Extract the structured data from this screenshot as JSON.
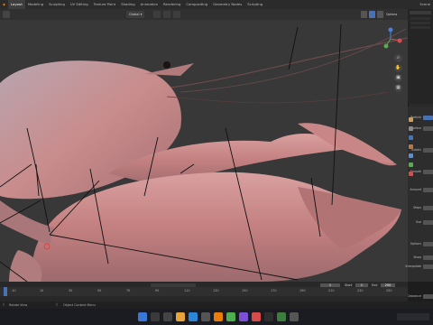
{
  "topbar": {
    "tabs": [
      "Layout",
      "Modeling",
      "Sculpting",
      "UV Editing",
      "Texture Paint",
      "Shading",
      "Animation",
      "Rendering",
      "Compositing",
      "Geometry Nodes",
      "Scripting"
    ],
    "active_tab": "Layout",
    "scene_label": "Scene"
  },
  "header": {
    "orientation_value": "Global",
    "options_label": "Options"
  },
  "timeline": {
    "frame_ticks": [
      "0",
      "20",
      "40",
      "60",
      "80",
      "100",
      "120",
      "140",
      "160",
      "180",
      "200",
      "220",
      "240"
    ],
    "ruler_ticks": [
      "-10",
      "10",
      "30",
      "50",
      "70",
      "90",
      "110",
      "130",
      "150",
      "170",
      "190",
      "210",
      "230",
      "250"
    ],
    "current_frame": "1",
    "start_label": "Start",
    "start_value": "1",
    "end_label": "End",
    "end_value": "250"
  },
  "properties": {
    "labels": [
      "Particle",
      "Surface",
      "Subdiv",
      "Smooth",
      "Amount",
      "Steps",
      "Use",
      "Options",
      "Show",
      "Interpolate",
      "Clearance"
    ]
  },
  "statusbar": {
    "left_hint": "Rotate View",
    "right_hint": "Object Context Menu"
  },
  "colors": {
    "accent": "#4772b3",
    "shrimp_body": "#c98a8a",
    "background": "#3a3a3a"
  }
}
